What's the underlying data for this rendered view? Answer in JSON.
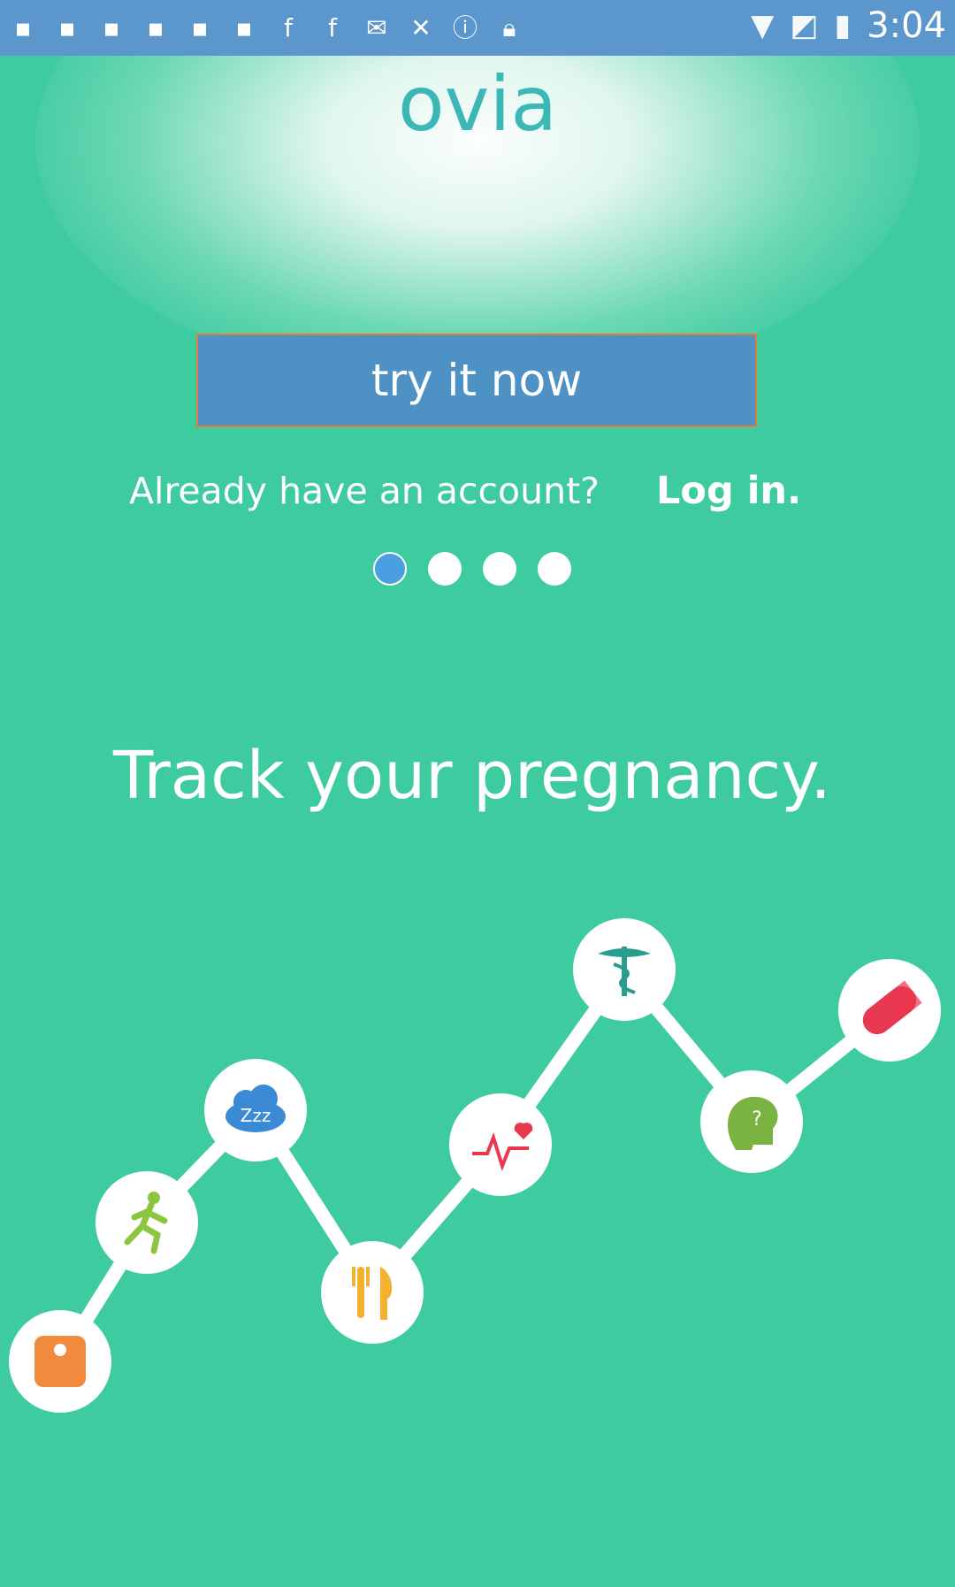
{
  "status_bar": {
    "time": "3:04",
    "left_icons": [
      "notification-icon",
      "notification-icon",
      "notification-icon",
      "notification-icon",
      "notification-icon",
      "notification-icon",
      "facebook-icon",
      "facebook-icon",
      "mail-icon",
      "satellite-icon",
      "alert-icon",
      "lock-icon"
    ],
    "right_icons": [
      "wifi-icon",
      "no-sim-icon",
      "battery-charging-icon"
    ]
  },
  "logo": {
    "text": "ovia"
  },
  "cta": {
    "label": "try it now"
  },
  "account": {
    "prompt": "Already have an account?",
    "login_label": "Log in."
  },
  "pager": {
    "count": 4,
    "active_index": 0
  },
  "headline": "Track your pregnancy.",
  "illustration": {
    "icons": [
      "scale-icon",
      "runner-icon",
      "sleep-cloud-icon",
      "fork-knife-icon",
      "heartbeat-icon",
      "caduceus-icon",
      "mind-question-icon",
      "pill-icon"
    ]
  },
  "colors": {
    "background": "#3ecba0",
    "status_bar": "#5b96cc",
    "button": "#4e91c5",
    "logo": "#3bb7b5",
    "active_dot": "#4a9fe0"
  }
}
